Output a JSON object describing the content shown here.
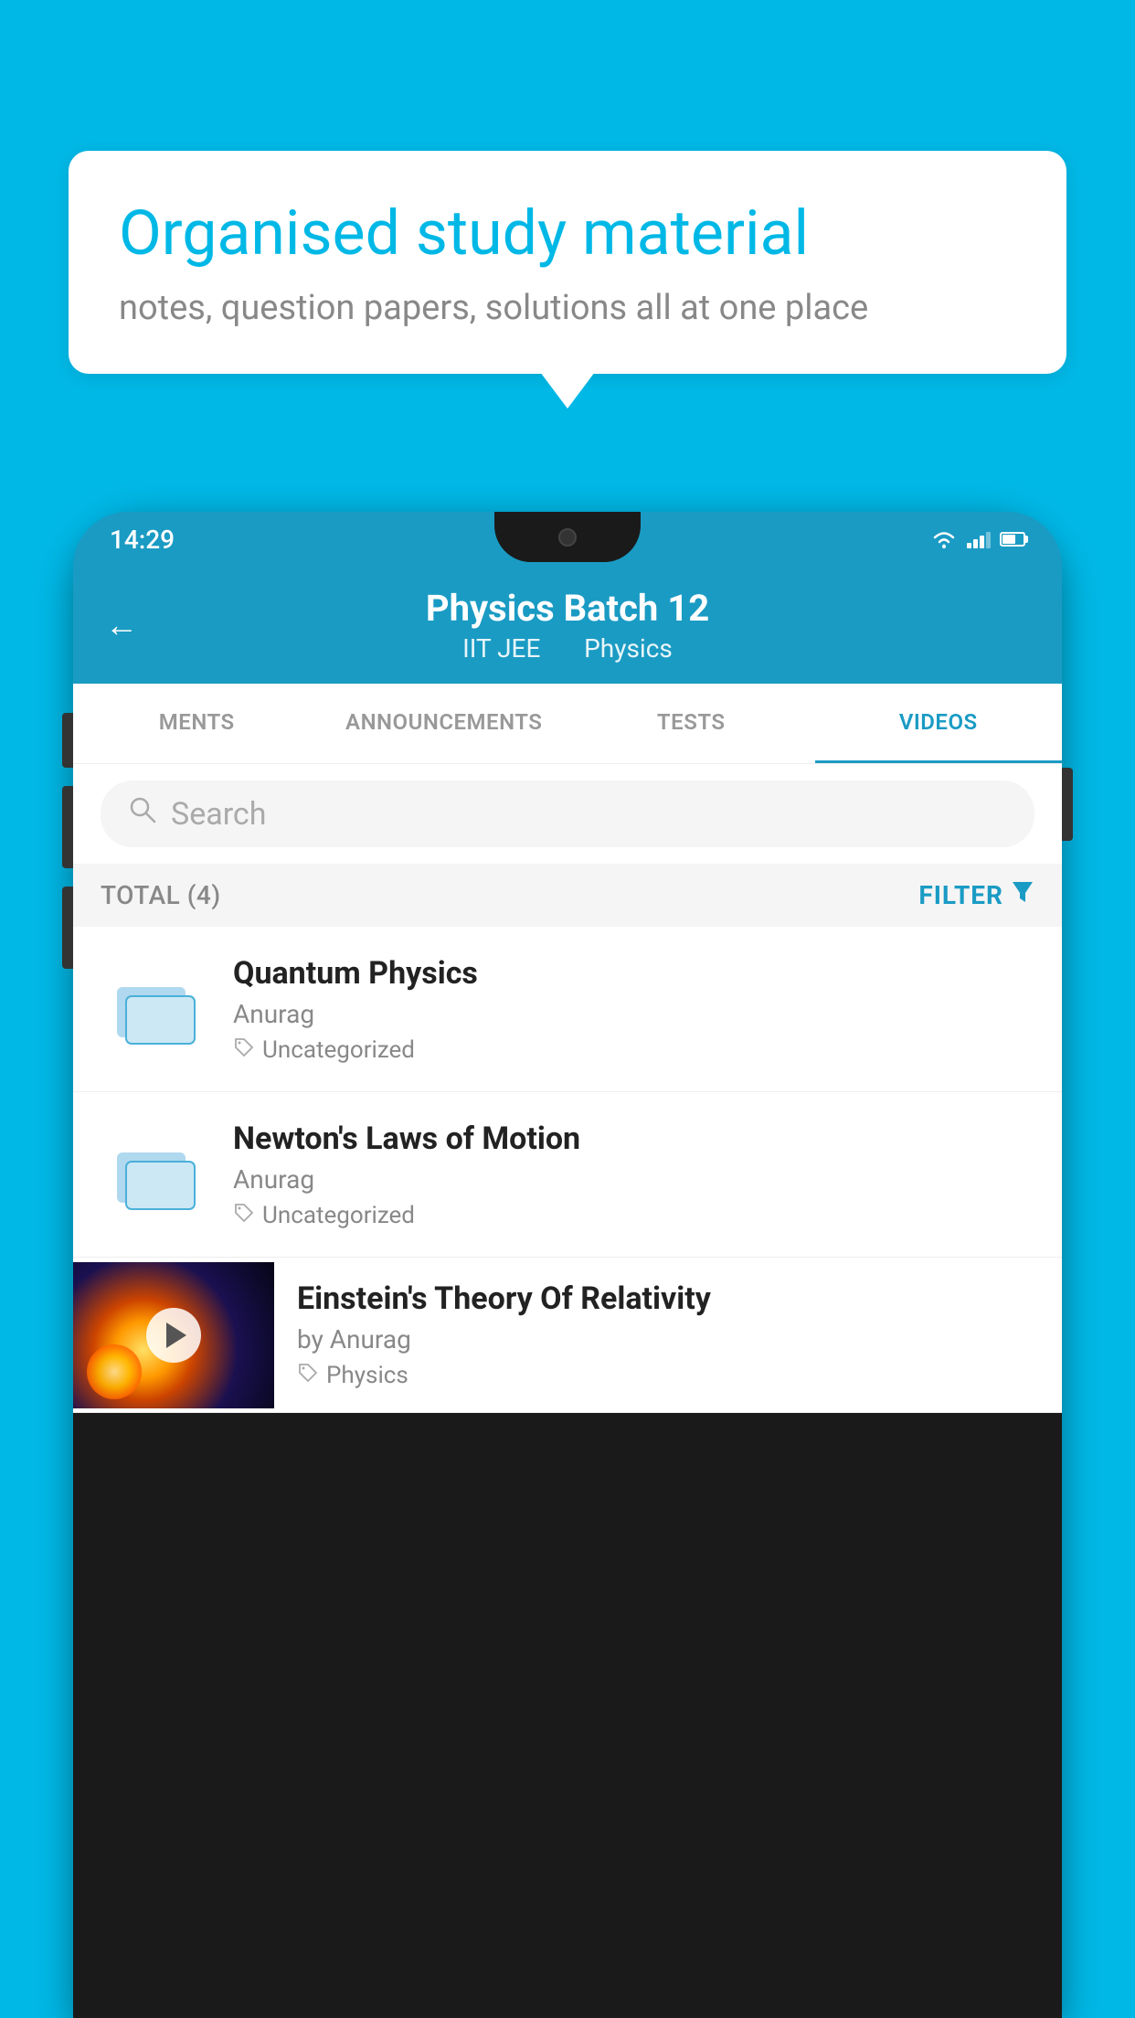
{
  "background_color": "#00b8e6",
  "bubble": {
    "title": "Organised study material",
    "subtitle": "notes, question papers, solutions all at one place"
  },
  "status_bar": {
    "time": "14:29"
  },
  "header": {
    "back_label": "←",
    "title": "Physics Batch 12",
    "tag1": "IIT JEE",
    "tag2": "Physics"
  },
  "tabs": [
    {
      "label": "MENTS",
      "active": false
    },
    {
      "label": "ANNOUNCEMENTS",
      "active": false
    },
    {
      "label": "TESTS",
      "active": false
    },
    {
      "label": "VIDEOS",
      "active": true
    }
  ],
  "search": {
    "placeholder": "Search"
  },
  "filter_bar": {
    "total_label": "TOTAL (4)",
    "filter_label": "FILTER"
  },
  "videos": [
    {
      "id": 1,
      "title": "Quantum Physics",
      "author": "Anurag",
      "tag": "Uncategorized",
      "has_thumbnail": false
    },
    {
      "id": 2,
      "title": "Newton's Laws of Motion",
      "author": "Anurag",
      "tag": "Uncategorized",
      "has_thumbnail": false
    },
    {
      "id": 3,
      "title": "Einstein's Theory Of Relativity",
      "author": "by Anurag",
      "tag": "Physics",
      "has_thumbnail": true
    }
  ]
}
